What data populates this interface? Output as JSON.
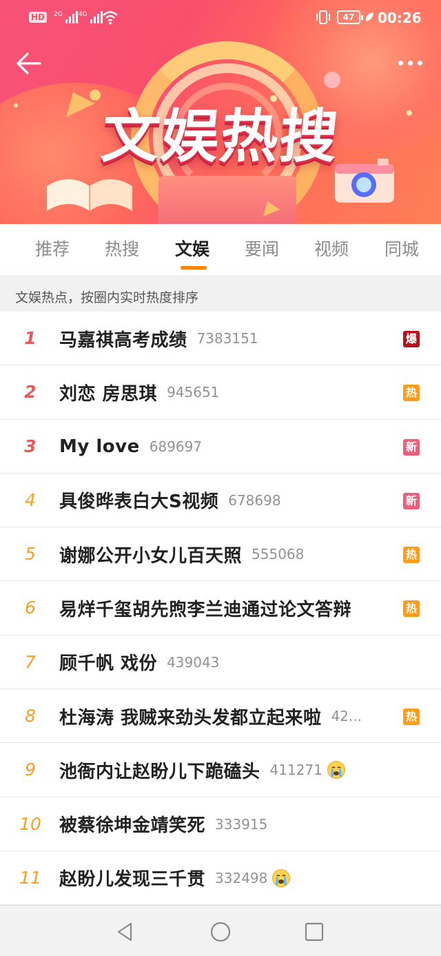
{
  "status_bar": {
    "hd": "HD",
    "sim1": "2G",
    "sim2": "4G",
    "battery": "47",
    "time": "00:26"
  },
  "banner": {
    "title": "文娱热搜"
  },
  "tabs": [
    {
      "label": "推荐"
    },
    {
      "label": "热搜"
    },
    {
      "label": "文娱"
    },
    {
      "label": "要闻"
    },
    {
      "label": "视频"
    },
    {
      "label": "同城"
    }
  ],
  "active_tab_index": 2,
  "note": "文娱热点，按圈内实时热度排序",
  "badge_colors": {
    "爆": "#b5121b",
    "热": "#ff9c1a",
    "新": "#ef5d7a"
  },
  "items": [
    {
      "rank": "1",
      "title": "马嘉祺高考成绩",
      "count": "7383151",
      "badge": "爆"
    },
    {
      "rank": "2",
      "title": "刘恋 房思琪",
      "count": "945651",
      "badge": "热"
    },
    {
      "rank": "3",
      "title": "My love",
      "count": "689697",
      "badge": "新"
    },
    {
      "rank": "4",
      "title": "具俊晔表白大S视频",
      "count": "678698",
      "badge": "新"
    },
    {
      "rank": "5",
      "title": "谢娜公开小女儿百天照",
      "count": "555068",
      "badge": "热"
    },
    {
      "rank": "6",
      "title": "易烊千玺胡先煦李兰迪通过论文答辩",
      "count": "",
      "badge": "热"
    },
    {
      "rank": "7",
      "title": "顾千帆 戏份",
      "count": "439043",
      "badge": ""
    },
    {
      "rank": "8",
      "title": "杜海涛 我贼来劲头发都立起来啦",
      "count": "42...",
      "badge": "热"
    },
    {
      "rank": "9",
      "title": "池衙内让赵盼儿下跪磕头",
      "count": "411271",
      "badge": "",
      "emoji": "crying-face-icon"
    },
    {
      "rank": "10",
      "title": "被蔡徐坤金靖笑死",
      "count": "333915",
      "badge": ""
    },
    {
      "rank": "11",
      "title": "赵盼儿发现三千贯",
      "count": "332498",
      "badge": "",
      "emoji": "crying-face-icon"
    }
  ]
}
